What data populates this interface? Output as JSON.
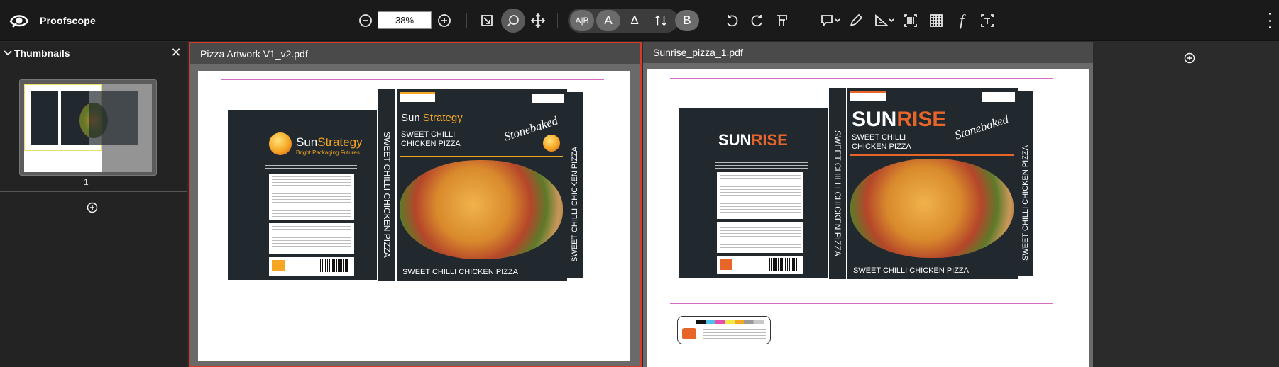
{
  "app": {
    "name": "Proofscope"
  },
  "toolbar": {
    "zoom_value": "38%",
    "pill_ab": "A|B",
    "pill_a": "A",
    "pill_delta": "Δ",
    "pill_b": "B",
    "text_tool": "f"
  },
  "sidebar": {
    "title": "Thumbnails",
    "close_label": "✕",
    "thumbnail_page_number": "1"
  },
  "documents": [
    {
      "tab_label": "Pizza Artwork V1_v2.pdf",
      "brand_name": "Sun",
      "brand_highlight": "Strategy",
      "brand_tagline": "Bright Packaging Futures",
      "product_line1": "SWEET CHILLI",
      "product_line2": "CHICKEN PIZZA",
      "side_text": "SWEET CHILLI CHICKEN PIZZA",
      "bottom_text": "SWEET CHILLI CHICKEN PIZZA",
      "script_text": "Stonebaked"
    },
    {
      "tab_label": "Sunrise_pizza_1.pdf",
      "brand_name": "SUN",
      "brand_highlight": "RISE",
      "product_line1": "SWEET CHILLI",
      "product_line2": "CHICKEN PIZZA",
      "side_text": "SWEET CHILLI CHICKEN PIZZA",
      "bottom_text": "SWEET CHILLI CHICKEN PIZZA",
      "script_text": "Stonebaked"
    }
  ],
  "colors": {
    "accent_red": "#d63a2a",
    "sun_orange": "#f5a623",
    "sunrise_orange": "#e8652a",
    "artwork_dark": "#21292f"
  }
}
